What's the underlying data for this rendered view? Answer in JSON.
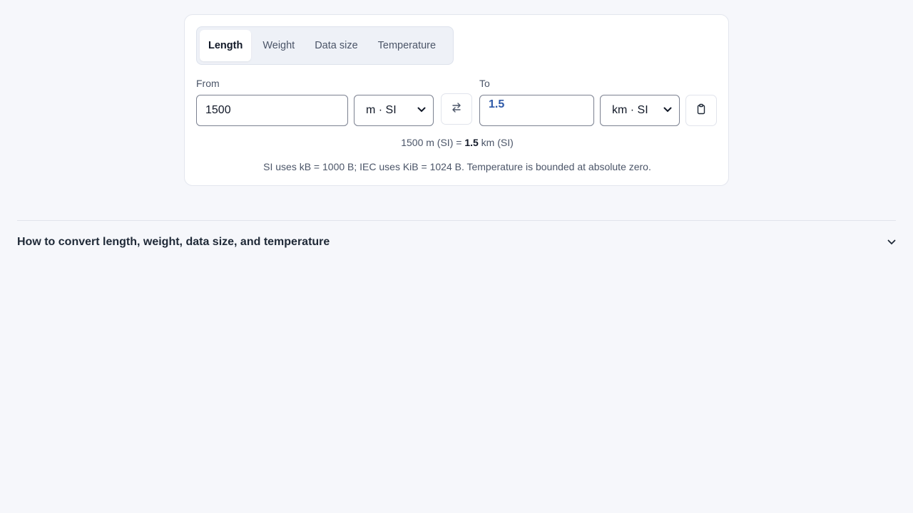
{
  "tabs": [
    {
      "label": "Length",
      "active": true
    },
    {
      "label": "Weight",
      "active": false
    },
    {
      "label": "Data size",
      "active": false
    },
    {
      "label": "Temperature",
      "active": false
    }
  ],
  "from": {
    "label": "From",
    "value": "1500",
    "unit": "m · SI"
  },
  "to": {
    "label": "To",
    "value": "1.5",
    "unit": "km · SI"
  },
  "summary": {
    "left": "1500 m (SI) =",
    "value": "1.5",
    "right": "km (SI)"
  },
  "note": "SI uses kB = 1000 B; IEC uses KiB = 1024 B. Temperature is bounded at absolute zero.",
  "faq": {
    "title": "How to convert length, weight, data size, and temperature"
  },
  "icons": {
    "swap": "swap-arrows-icon",
    "copy": "clipboard-icon",
    "expand": "chevron-down-icon"
  },
  "colors": {
    "accent": "#2f5aa8",
    "background": "#f6f7fb"
  }
}
